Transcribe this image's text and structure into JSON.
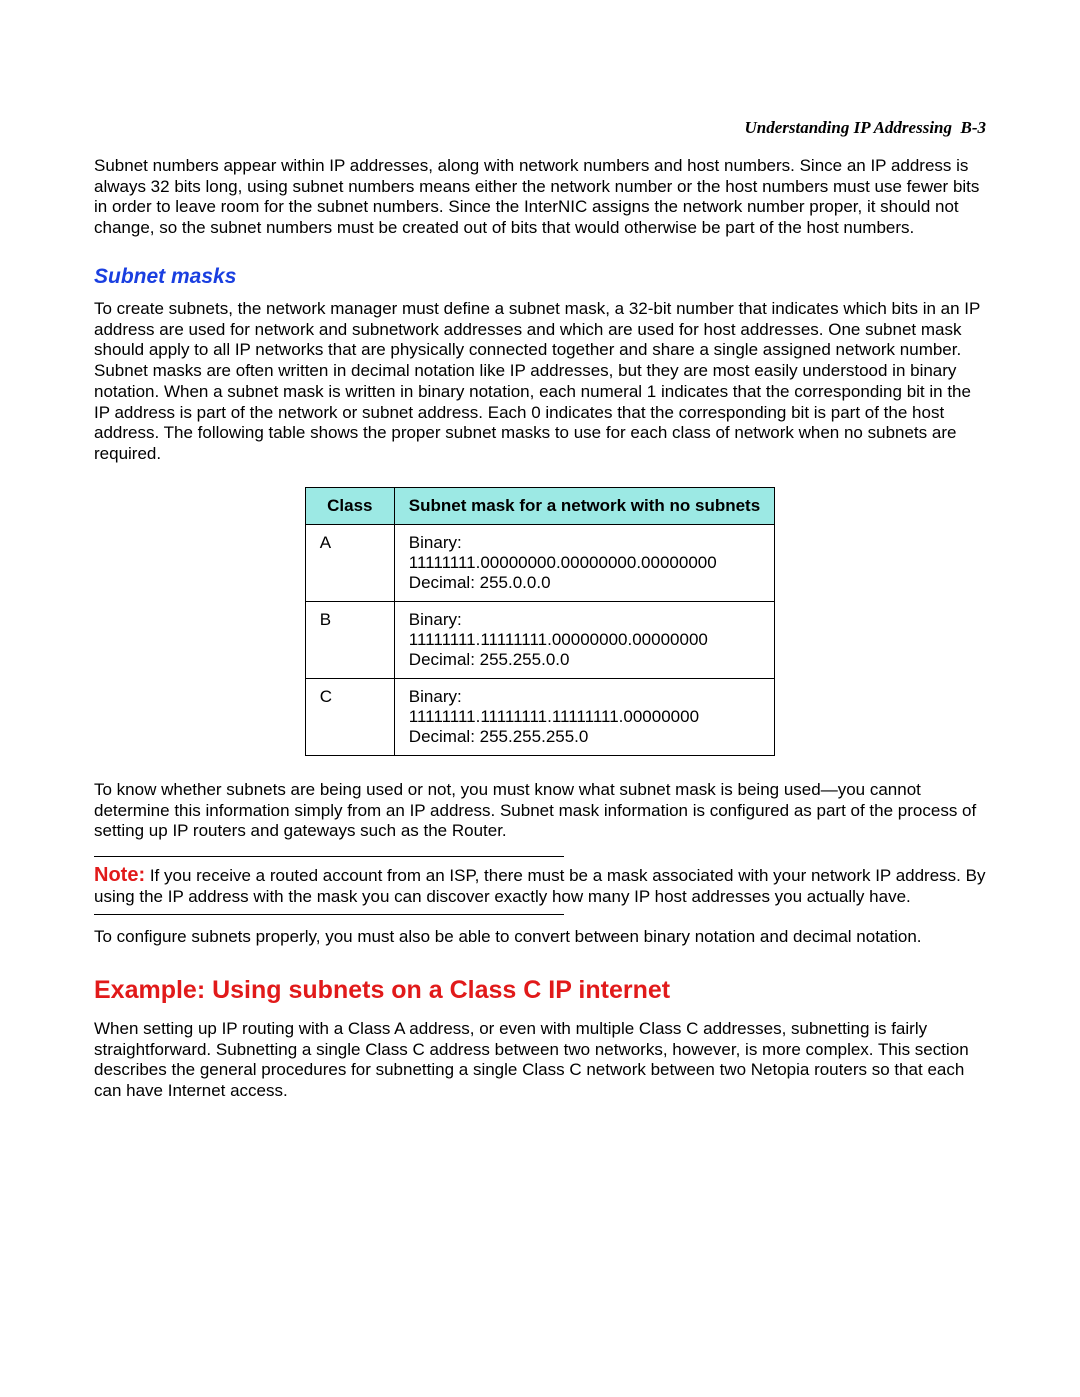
{
  "header": {
    "title": "Understanding IP Addressing",
    "page": "B-3"
  },
  "paragraphs": {
    "intro": "Subnet numbers appear within IP addresses, along with network numbers and host numbers. Since an IP address is always 32 bits long, using subnet numbers means either the network number or the host numbers must use fewer bits in order to leave room for the subnet numbers. Since the InterNIC assigns the network number proper, it should not change, so the subnet numbers must be created out of bits that would otherwise be part of the host numbers.",
    "subnet_heading": "Subnet masks",
    "subnet_body": "To create subnets, the network manager must define a subnet mask, a 32-bit number that indicates which bits in an IP address are used for network and subnetwork addresses and which are used for host addresses. One subnet mask should apply to all IP networks that are physically connected together and share a single assigned network number. Subnet masks are often written in decimal notation like IP addresses, but they are most easily understood in binary notation. When a subnet mask is written in binary notation, each numeral 1 indicates that the corresponding bit in the IP address is part of the network or subnet address. Each 0 indicates that the corresponding bit is part of the host address. The following table shows the proper subnet masks to use for each class of network when no subnets are required.",
    "after_table": "To know whether subnets are being used or not, you must know what subnet mask is being used—you cannot determine this information simply from an IP address. Subnet mask information is configured as part of the process of setting up IP routers and gateways such as the Router.",
    "note_label": "Note:",
    "note_body": "  If you receive a routed account from an ISP, there must be a mask associated with your network IP address. By using the IP address with the mask you can discover exactly how many IP host addresses you actually have.",
    "after_note": "To configure subnets properly, you must also be able to convert between binary notation and decimal notation.",
    "example_heading": "Example: Using subnets on a Class C IP internet",
    "example_body": "When setting up IP routing with a Class A address, or even with multiple Class C addresses, subnetting is fairly straightforward. Subnetting a single Class C address between two networks, however, is more complex. This section describes the general procedures for subnetting a single Class C network between two Netopia routers so that each can have Internet access."
  },
  "table": {
    "headers": {
      "class": "Class",
      "mask": "Subnet mask for a network with no subnets"
    },
    "rows": [
      {
        "class": "A",
        "binary_label": "Binary:",
        "binary": "11111111.00000000.00000000.00000000",
        "decimal": "Decimal: 255.0.0.0"
      },
      {
        "class": "B",
        "binary_label": "Binary:",
        "binary": "11111111.11111111.00000000.00000000",
        "decimal": "Decimal: 255.255.0.0"
      },
      {
        "class": "C",
        "binary_label": "Binary:",
        "binary": "11111111.11111111.11111111.00000000",
        "decimal": "Decimal: 255.255.255.0"
      }
    ]
  }
}
